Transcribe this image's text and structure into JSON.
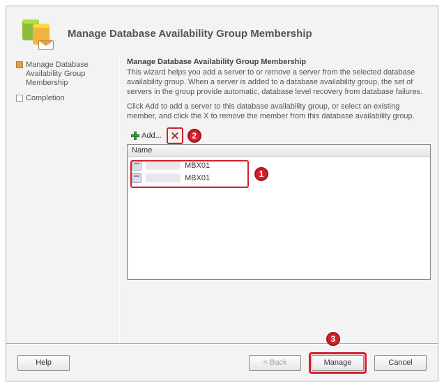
{
  "header": {
    "title": "Manage Database Availability Group Membership"
  },
  "sidebar": {
    "items": [
      {
        "label": "Manage Database Availability Group Membership",
        "active": true
      },
      {
        "label": "Completion",
        "active": false
      }
    ]
  },
  "main": {
    "subtitle": "Manage Database Availability Group Membership",
    "description1": "This wizard helps you add a server to or remove a server from the selected database availability group. When a server is added to a database availability group, the set of servers in the group provide automatic, database level recovery from database failures.",
    "description2": "Click Add to add a server to this database availability group, or select an existing member, and click the X to remove the member from this database availability group.",
    "toolbar": {
      "add_label": "Add..."
    },
    "list": {
      "header": "Name",
      "rows": [
        {
          "name": "MBX01"
        },
        {
          "name": "MBX01"
        }
      ]
    }
  },
  "callouts": {
    "c1": "1",
    "c2": "2",
    "c3": "3"
  },
  "footer": {
    "help": "Help",
    "back": "< Back",
    "manage": "Manage",
    "cancel": "Cancel"
  }
}
